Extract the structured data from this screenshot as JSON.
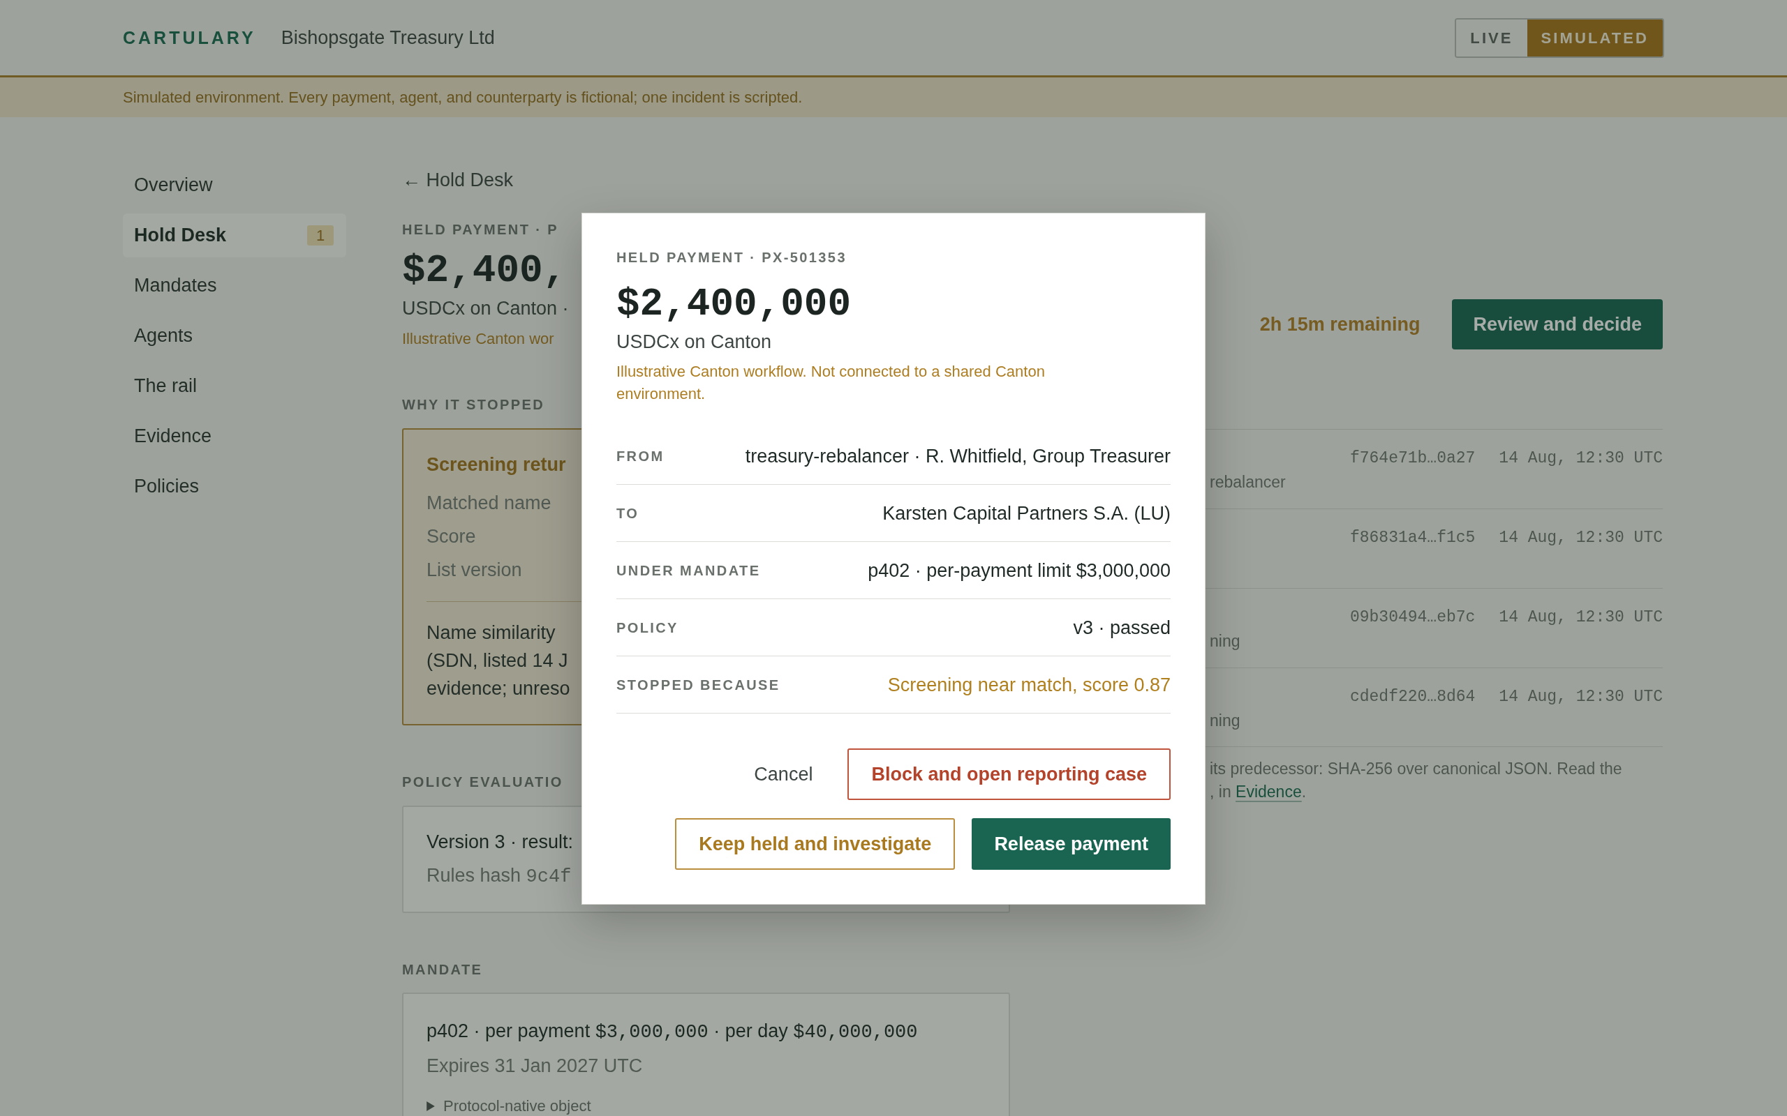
{
  "header": {
    "logo": "CARTULARY",
    "organization": "Bishopsgate Treasury Ltd",
    "environment_toggle": [
      {
        "label": "LIVE",
        "selected": false
      },
      {
        "label": "SIMULATED",
        "selected": true
      }
    ]
  },
  "banner": {
    "text": "Simulated environment. Every payment, agent, and counterparty is fictional; one incident is scripted."
  },
  "sidebar": {
    "items": [
      {
        "label": "Overview",
        "selected": false
      },
      {
        "label": "Hold Desk",
        "selected": true,
        "badge": "1"
      },
      {
        "label": "Mandates",
        "selected": false
      },
      {
        "label": "Agents",
        "selected": false
      },
      {
        "label": "The rail",
        "selected": false
      },
      {
        "label": "Evidence",
        "selected": false
      },
      {
        "label": "Policies",
        "selected": false
      }
    ]
  },
  "page": {
    "back_link": "← Hold Desk",
    "eyebrow": "HELD PAYMENT · P",
    "amount": "$2,400,",
    "asset": "USDCx on Canton ·",
    "note": "Illustrative Canton wor",
    "time_remaining": "2h 15m remaining",
    "primary_action": "Review and decide"
  },
  "why_it_stopped": {
    "heading": "WHY IT STOPPED",
    "title": "Screening retur",
    "fields": [
      "Matched name",
      "Score",
      "List version"
    ],
    "explanation_lines": [
      "Name similarity",
      "(SDN, listed 14 J",
      "evidence; unreso"
    ]
  },
  "policy_evaluation": {
    "heading": "POLICY EVALUATIO",
    "result": "Version 3 · result:",
    "hash_label": "Rules hash",
    "hash_value": "9c4f"
  },
  "mandate": {
    "heading": "MANDATE",
    "summary": [
      {
        "kind": "text",
        "text": "p402 · per payment"
      },
      {
        "kind": "figure",
        "text": "$3,000,000"
      },
      {
        "kind": "text",
        "text": "· per day"
      },
      {
        "kind": "figure",
        "text": "$40,000,000"
      }
    ],
    "expiry": "Expires 31 Jan 2027 UTC",
    "disclosure": {
      "label": "Protocol-native object",
      "expanded": false
    }
  },
  "chain": {
    "rows": [
      {
        "detail": "rebalancer",
        "hash": "f764e71b…0a27",
        "time": "14 Aug, 12:30 UTC"
      },
      {
        "hash": "f86831a4…f1c5",
        "time": "14 Aug, 12:30 UTC"
      },
      {
        "detail": "ning",
        "hash": "09b30494…eb7c",
        "time": "14 Aug, 12:30 UTC"
      },
      {
        "detail": "ning",
        "hash": "cdedf220…8d64",
        "time": "14 Aug, 12:30 UTC"
      }
    ],
    "note": {
      "text": "its predecessor: SHA-256 over canonical JSON. Read the",
      "continuation": ", in",
      "link": "Evidence",
      "end": "."
    }
  },
  "modal": {
    "eyebrow": "HELD PAYMENT · PX-501353",
    "amount": "$2,400,000",
    "asset": "USDCx on Canton",
    "note": "Illustrative Canton workflow. Not connected to a shared Canton environment.",
    "details": [
      {
        "label": "FROM",
        "value": "treasury-rebalancer · R. Whitfield, Group Treasurer",
        "kind": "plain"
      },
      {
        "label": "TO",
        "value": "Karsten Capital Partners S.A. (LU)",
        "kind": "plain"
      },
      {
        "label": "UNDER MANDATE",
        "value": "p402 · per-payment limit $3,000,000",
        "kind": "plain"
      },
      {
        "label": "POLICY",
        "value": "v3 · passed",
        "kind": "plain"
      },
      {
        "label": "STOPPED BECAUSE",
        "value": "Screening near match, score 0.87",
        "kind": "warning"
      }
    ],
    "actions": [
      {
        "label": "Cancel",
        "kind": "ghost"
      },
      {
        "label": "Block and open reporting case",
        "kind": "danger"
      },
      {
        "label": "Keep held and investigate",
        "kind": "caution"
      },
      {
        "label": "Release payment",
        "kind": "primary"
      }
    ]
  }
}
